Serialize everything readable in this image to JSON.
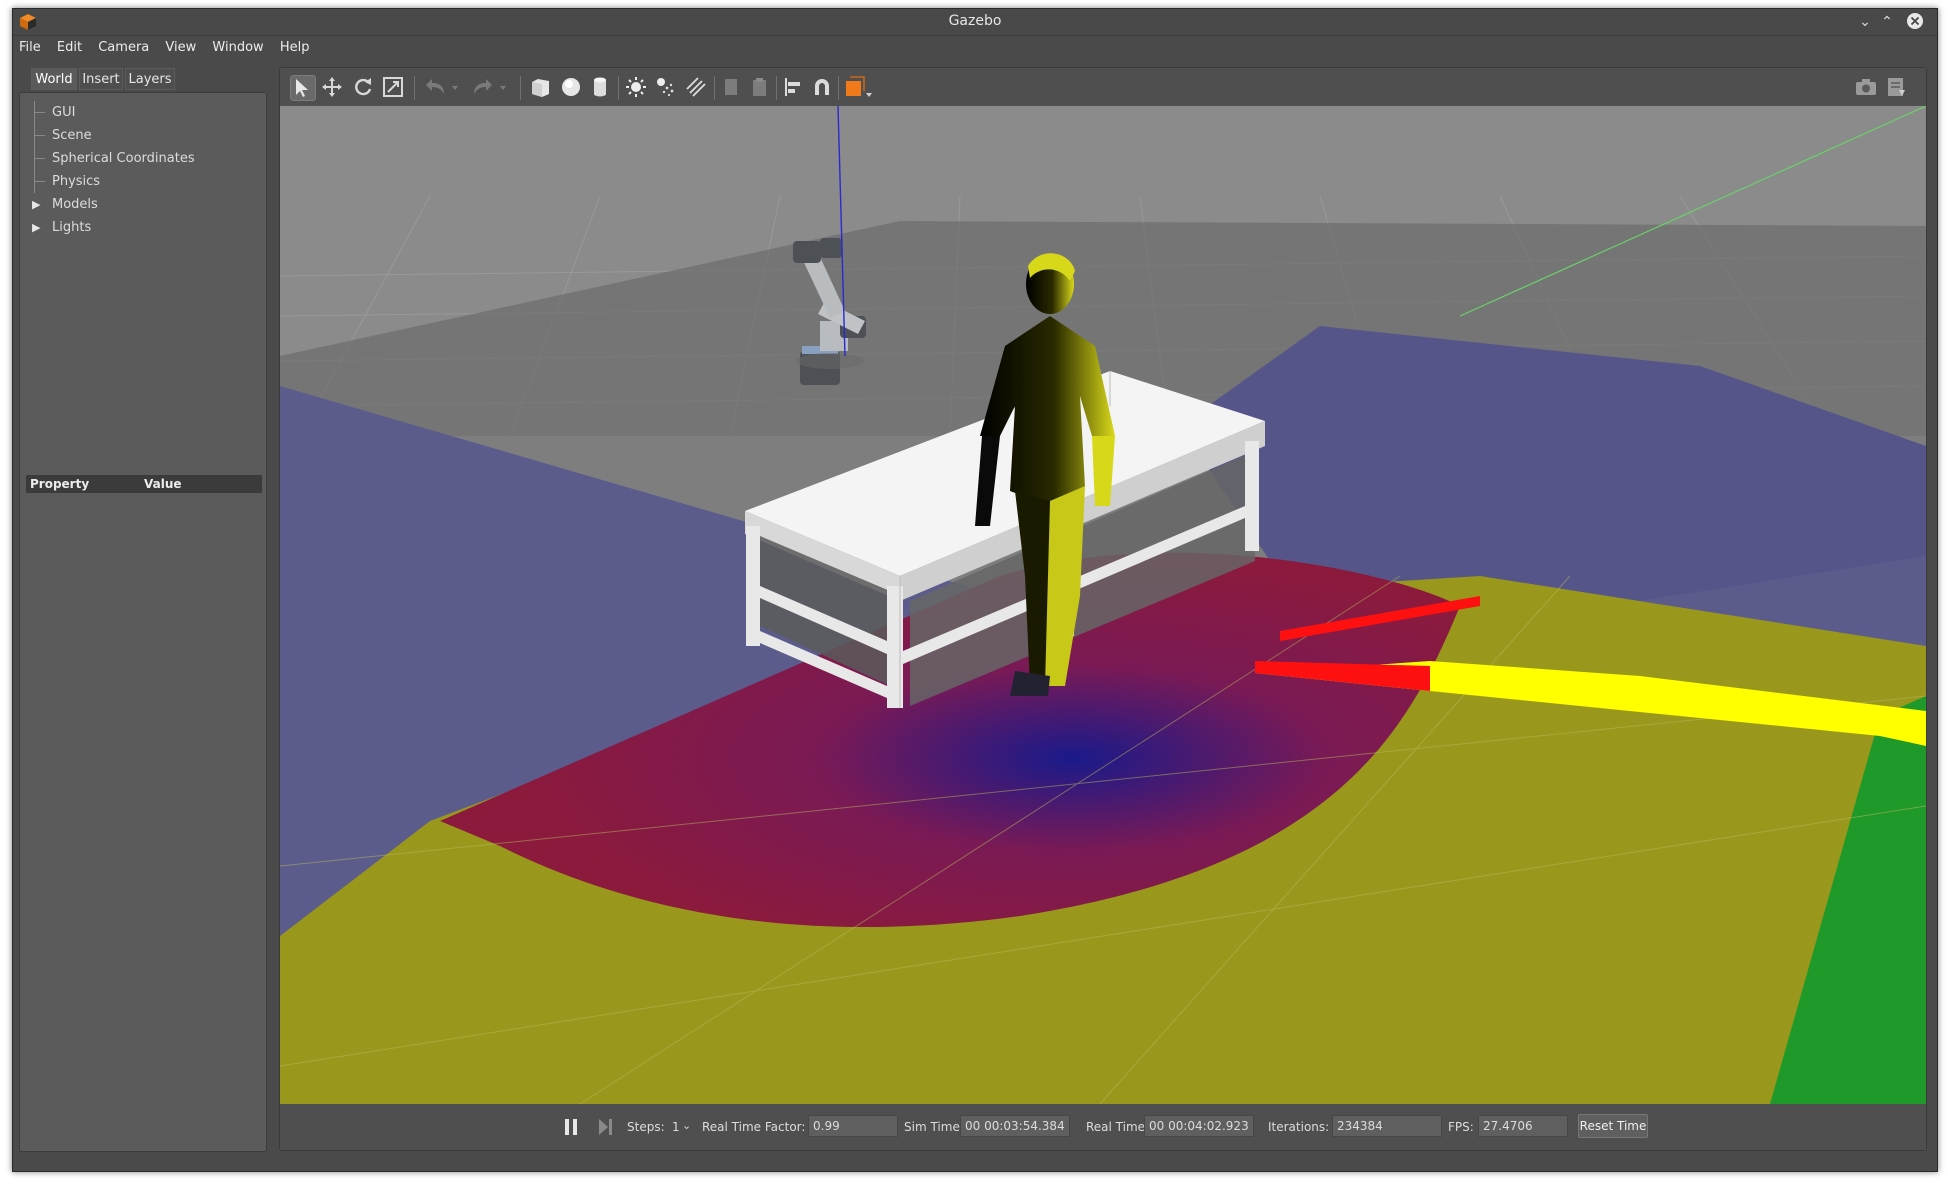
{
  "window": {
    "title": "Gazebo"
  },
  "menu": [
    "File",
    "Edit",
    "Camera",
    "View",
    "Window",
    "Help"
  ],
  "left_panel": {
    "tabs": [
      "World",
      "Insert",
      "Layers"
    ],
    "active_tab": "World",
    "tree": [
      {
        "label": "GUI",
        "expandable": false
      },
      {
        "label": "Scene",
        "expandable": false
      },
      {
        "label": "Spherical Coordinates",
        "expandable": false
      },
      {
        "label": "Physics",
        "expandable": false
      },
      {
        "label": "Models",
        "expandable": true
      },
      {
        "label": "Lights",
        "expandable": true
      }
    ],
    "property_header": {
      "property": "Property",
      "value": "Value"
    }
  },
  "toolbar": {
    "tools": [
      "select-arrow-icon",
      "translate-icon",
      "rotate-icon",
      "scale-icon",
      "undo-icon",
      "redo-icon",
      "box-icon",
      "sphere-icon",
      "cylinder-icon",
      "point-light-icon",
      "spot-light-icon",
      "directional-light-icon",
      "copy-icon",
      "paste-icon",
      "align-icon",
      "snap-icon",
      "view-angle-icon",
      "screenshot-icon",
      "log-icon"
    ],
    "active_tool": "select-arrow-icon"
  },
  "bottom_bar": {
    "steps_label": "Steps:",
    "steps_value": "1",
    "rtf_label": "Real Time Factor:",
    "rtf_value": "0.99",
    "sim_time_label": "Sim Time:",
    "sim_time_value": "00 00:03:54.384",
    "real_time_label": "Real Time:",
    "real_time_value": "00 00:04:02.923",
    "iterations_label": "Iterations:",
    "iterations_value": "234384",
    "fps_label": "FPS:",
    "fps_value": "27.4706",
    "reset_label": "Reset Time"
  },
  "colors": {
    "zone_yellow": "#9c9a1c",
    "zone_red": "#8a1a3a",
    "zone_blue": "#5b5b8a",
    "zone_green": "#1f9a2a",
    "laser_red": "#ff1010",
    "laser_yellow": "#ffff00",
    "grid_floor": "#7d7d7d",
    "sky": "#8b8b8b"
  }
}
